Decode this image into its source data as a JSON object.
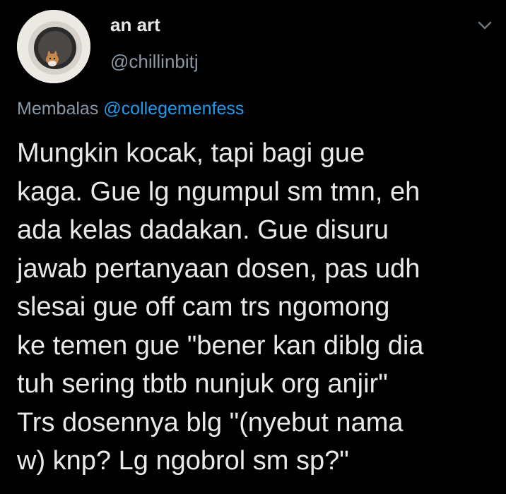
{
  "author": {
    "display_name": "an art",
    "handle": "@chillinbitj",
    "avatar_icon": "avatar-image-cat-in-washing-machine"
  },
  "menu": {
    "icon": "chevron-down-icon"
  },
  "reply": {
    "prefix": "Membalas",
    "mention": "@collegemenfess"
  },
  "tweet": {
    "lines": [
      "Mungkin kocak, tapi bagi gue",
      "kaga. Gue lg ngumpul sm tmn, eh",
      "ada kelas dadakan. Gue disuru",
      "jawab pertanyaan dosen, pas udh",
      "slesai gue off cam trs ngomong",
      "ke temen gue \"bener kan diblg dia",
      "tuh sering tbtb nunjuk org anjir\"",
      "Trs dosennya blg \"(nyebut nama",
      "w) knp? Lg ngobrol sm sp?\""
    ]
  },
  "colors": {
    "background": "#000000",
    "text": "#e7e9ea",
    "secondary": "#8b98a5",
    "link": "#1d9bf0"
  }
}
